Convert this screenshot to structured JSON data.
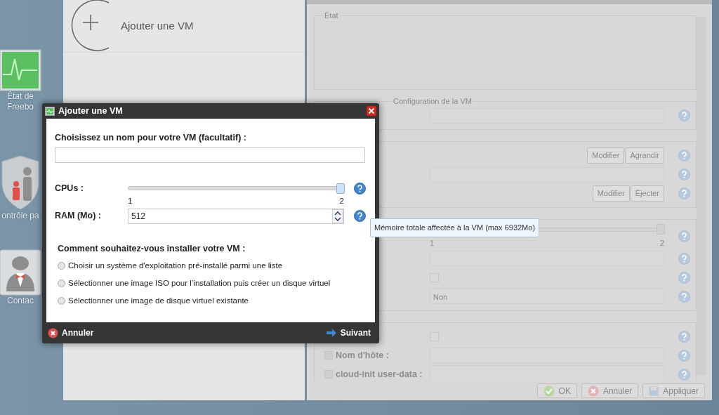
{
  "desktop_icons": [
    {
      "kind": "monitor",
      "lines": [
        "État de",
        "Freebo"
      ]
    },
    {
      "kind": "shield",
      "lines": [
        "ontrôle pa"
      ]
    },
    {
      "kind": "contact",
      "lines": [
        "Contac"
      ]
    }
  ],
  "side_panel": {
    "add_item": "Ajouter une VM"
  },
  "vm_panel": {
    "state_legend": "État",
    "config_legend": "Configuration de la VM",
    "groups": [
      {
        "rows": [
          {
            "kind": "field"
          }
        ]
      },
      {
        "rows": [
          {
            "kind": "buttons",
            "buttons": [
              "Modifier",
              "Agrandir"
            ]
          },
          {
            "kind": "select"
          },
          {
            "kind": "buttons",
            "buttons": [
              "Modifier",
              "Éjecter"
            ]
          }
        ]
      },
      {
        "rows": [
          {
            "kind": "slider",
            "min": "1",
            "max": "2",
            "level": 1
          },
          {
            "kind": "spinner"
          },
          {
            "kind": "checkbox",
            "checked": false
          },
          {
            "kind": "select",
            "value": "Non"
          }
        ]
      },
      {
        "rows": [
          {
            "kind": "checkbox",
            "checked": false
          },
          {
            "kind": "field",
            "label": "Nom d'hôte :"
          },
          {
            "kind": "textarea",
            "label": "cloud-init user-data :"
          }
        ]
      }
    ],
    "footer_buttons": [
      {
        "kind": "ok",
        "label": "OK"
      },
      {
        "kind": "cancel",
        "label": "Annuler"
      },
      {
        "kind": "save",
        "label": "Appliquer"
      }
    ]
  },
  "dialog": {
    "title": "Ajouter une VM",
    "name_label": "Choisissez un nom pour votre VM (facultatif) :",
    "cpu_label": "CPUs :",
    "cpu_slider": {
      "level": 1,
      "min": "1",
      "max": "2"
    },
    "ram_label": "RAM (Mo) :",
    "ram_value": "512",
    "install_question": "Comment souhaitez-vous installer votre VM :",
    "install_options": [
      {
        "label": "Choisir un système d'exploitation pré-installé parmi une liste",
        "selected": false
      },
      {
        "label": "Sélectionner une image ISO pour l’installation puis créer un disque virtuel",
        "selected": false
      },
      {
        "label": "Sélectionner une image de disque virtuel existante",
        "selected": false
      }
    ],
    "cancel": "Annuler",
    "next": "Suivant"
  },
  "tooltip": "Mémoire totale affectée à la VM (max 6932Mo)"
}
